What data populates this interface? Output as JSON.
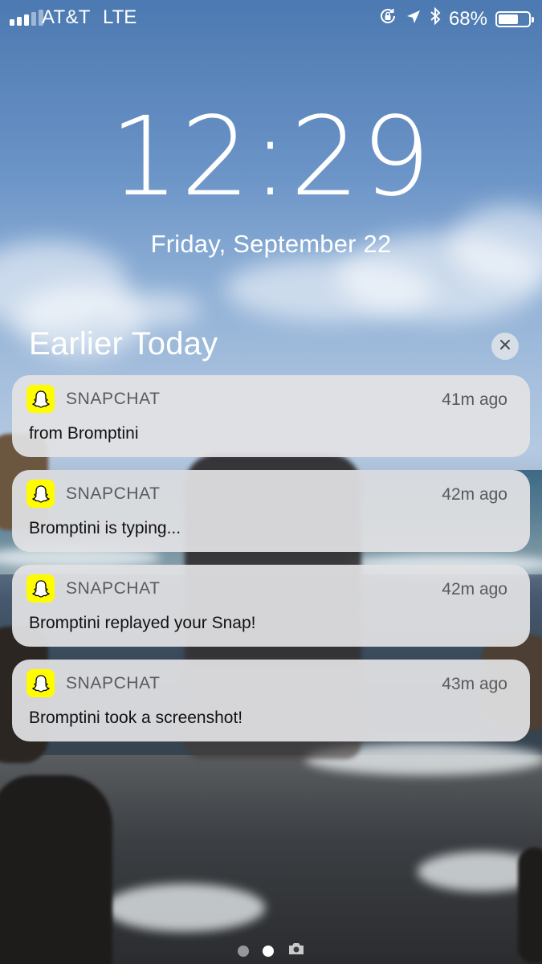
{
  "status_bar": {
    "carrier": "AT&T",
    "network": "LTE",
    "battery_percent": "68%",
    "battery_level": 0.68,
    "signal_bars_active": 3,
    "signal_bars_total": 5,
    "icons": [
      "orientation-lock-icon",
      "location-arrow-icon",
      "bluetooth-icon"
    ]
  },
  "lock_screen": {
    "time": "12:29",
    "date": "Friday, September 22"
  },
  "notifications_section": {
    "title": "Earlier Today",
    "clear_icon": "close-icon"
  },
  "notifications": [
    {
      "app": "SNAPCHAT",
      "time": "41m ago",
      "body": "from Bromptini",
      "icon": "snapchat-ghost-icon"
    },
    {
      "app": "SNAPCHAT",
      "time": "42m ago",
      "body": "Bromptini is typing...",
      "icon": "snapchat-ghost-icon"
    },
    {
      "app": "SNAPCHAT",
      "time": "42m ago",
      "body": "Bromptini replayed your Snap!",
      "icon": "snapchat-ghost-icon"
    },
    {
      "app": "SNAPCHAT",
      "time": "43m ago",
      "body": "Bromptini took a screenshot!",
      "icon": "snapchat-ghost-icon"
    }
  ],
  "page_indicator": {
    "pages": 2,
    "active_page": 2,
    "extra_icon": "camera-icon"
  },
  "colors": {
    "snapchat_yellow": "#fffc00",
    "notification_bg": "#e2e2e4",
    "text_secondary": "#5a5a5e"
  }
}
